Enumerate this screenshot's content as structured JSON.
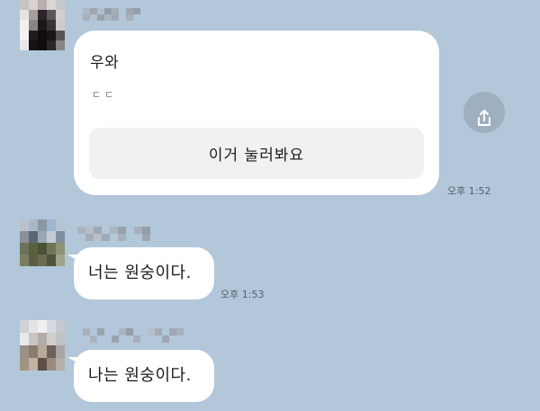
{
  "messages": [
    {
      "type": "card",
      "title": "우와",
      "subtitle": "ㄷㄷ",
      "button_label": "이거 눌러봐요",
      "time": "오후 1:52",
      "share_icon": "share-icon"
    },
    {
      "type": "text",
      "text": "너는 원숭이다.",
      "time": "오후 1:53"
    },
    {
      "type": "text",
      "text": "나는 원숭이다."
    }
  ],
  "colors": {
    "background": "#b2c7d9",
    "bubble": "#ffffff",
    "card_button": "#f1f1f2",
    "share_button": "#9eafbf"
  }
}
